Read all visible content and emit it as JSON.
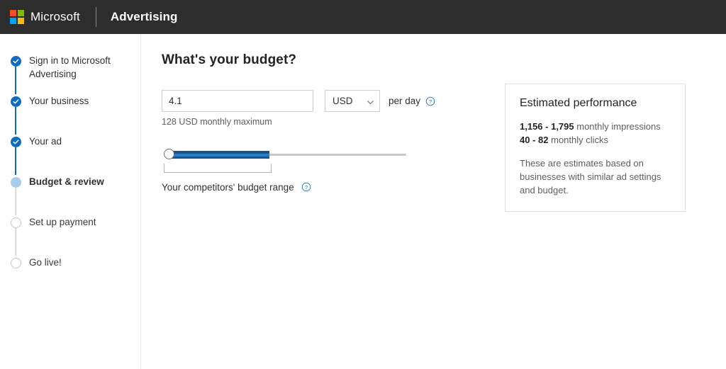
{
  "header": {
    "brand": "Microsoft",
    "app_name": "Advertising",
    "logo_colors": {
      "top_left": "#f25022",
      "top_right": "#7fba00",
      "bottom_left": "#00a4ef",
      "bottom_right": "#ffb900"
    },
    "background": "#2d2d2d"
  },
  "sidebar": {
    "steps": [
      {
        "label": "Sign in to Microsoft Advertising",
        "state": "done"
      },
      {
        "label": "Your business",
        "state": "done"
      },
      {
        "label": "Your ad",
        "state": "done"
      },
      {
        "label": "Budget & review",
        "state": "current"
      },
      {
        "label": "Set up payment",
        "state": "todo"
      },
      {
        "label": "Go live!",
        "state": "todo"
      }
    ],
    "accent_color": "#0f6cbd",
    "current_color": "#a8cdeb"
  },
  "main": {
    "title": "What's your budget?",
    "budget_input": {
      "value": "4.1",
      "placeholder": ""
    },
    "currency": {
      "selected": "USD",
      "options": [
        "USD"
      ]
    },
    "per_day_label": "per day",
    "budget_help_icon": "help-circle-icon",
    "monthly_maximum_note": "128 USD monthly maximum",
    "slider": {
      "value_percent": 40,
      "fill_color": "#16558f",
      "track_color": "#c8c6c4"
    },
    "competitors_range_label": "Your competitors' budget range",
    "competitors_help_icon": "help-circle-icon"
  },
  "estimate_card": {
    "title": "Estimated performance",
    "impressions_value": "1,156 - 1,795",
    "impressions_label": "monthly impressions",
    "clicks_value": "40 - 82",
    "clicks_label": "monthly clicks",
    "note": "These are estimates based on businesses with similar ad settings and budget."
  }
}
